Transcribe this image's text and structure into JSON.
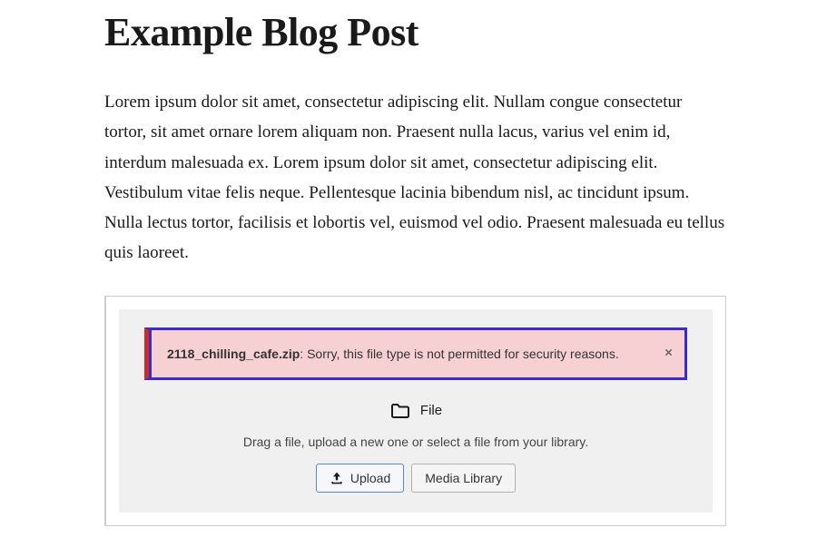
{
  "post": {
    "title": "Example Blog Post",
    "content": "Lorem ipsum dolor sit amet, consectetur adipiscing elit. Nullam congue consectetur tortor, sit amet ornare lorem aliquam non. Praesent nulla lacus, varius vel enim id, interdum malesuada ex. Lorem ipsum dolor sit amet, consectetur adipiscing elit. Vestibulum vitae felis neque.  Pellentesque lacinia bibendum nisl, ac tincidunt ipsum. Nulla lectus  tortor, facilisis et lobortis vel, euismod vel odio. Praesent malesuada  eu tellus quis laoreet."
  },
  "fileBlock": {
    "error": {
      "filename": "2118_chilling_cafe.zip",
      "message": ": Sorry, this file type is not permitted for security reasons."
    },
    "label": "File",
    "instructions": "Drag a file, upload a new one or select a file from your library.",
    "buttons": {
      "upload": "Upload",
      "mediaLibrary": "Media Library"
    }
  }
}
